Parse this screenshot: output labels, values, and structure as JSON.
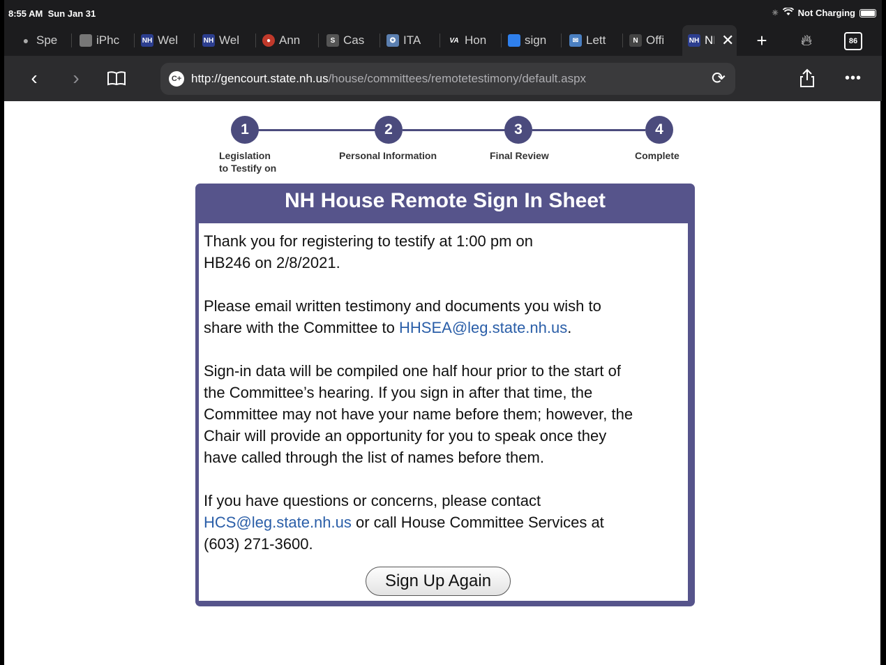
{
  "status_bar": {
    "time": "8:55 AM",
    "date": "Sun Jan 31",
    "charging": "Not Charging"
  },
  "tabs": [
    {
      "label": "Spe",
      "icon": "apple-icon",
      "color": "#555555"
    },
    {
      "label": "iPhc",
      "icon": "apple-icon",
      "color": "#777777"
    },
    {
      "label": "Wel",
      "icon": "nh-icon",
      "color": "#2c3e8f"
    },
    {
      "label": "Wel",
      "icon": "nh-icon",
      "color": "#2c3e8f"
    },
    {
      "label": "Ann",
      "icon": "seal-icon",
      "color": "#c0392b"
    },
    {
      "label": "Cas",
      "icon": "s-icon",
      "color": "#555555"
    },
    {
      "label": "ITA",
      "icon": "seal-icon",
      "color": "#5b7fb0"
    },
    {
      "label": "Hon",
      "icon": "va-icon",
      "color": "#1b2a5e"
    },
    {
      "label": "sign",
      "icon": "square-icon",
      "color": "#2f80ed"
    },
    {
      "label": "Lett",
      "icon": "mail-icon",
      "color": "#4a7fc1"
    },
    {
      "label": "Offi",
      "icon": "n-icon",
      "color": "#333333"
    },
    {
      "label": "NH \\",
      "icon": "nh-icon",
      "color": "#2c3e8f",
      "active": true
    }
  ],
  "tab_count": "86",
  "url": {
    "host": "http://gencourt.state.nh.us",
    "path": "/house/committees/remotetestimony/default.aspx"
  },
  "steps": [
    {
      "number": "1",
      "label": "Legislation\nto Testify on"
    },
    {
      "number": "2",
      "label": "Personal Information"
    },
    {
      "number": "3",
      "label": "Final Review"
    },
    {
      "number": "4",
      "label": "Complete"
    }
  ],
  "panel": {
    "title": "NH House Remote Sign In Sheet",
    "p1_line1": "Thank you for registering to testify  at 1:00 pm on",
    "p1_line2": "HB246 on 2/8/2021.",
    "p2_line1": "Please email written testimony and documents you wish to",
    "p2_line2_pre": "share with the Committee to ",
    "p2_email": "HHSEA@leg.state.nh.us",
    "p2_line2_post": ".",
    "p3_line1": "Sign-in data will be compiled one half hour prior to the start of",
    "p3_line2": "the Committee’s hearing. If you sign in after that time, the",
    "p3_line3": "Committee may not have your name before them; however, the",
    "p3_line4": "Chair will provide an opportunity for you to speak once they",
    "p3_line5": "have called through the list of names before them.",
    "p4_line1": "If you have questions or concerns, please contact",
    "p4_email": "HCS@leg.state.nh.us",
    "p4_line2_post": " or call House Committee Services at",
    "p4_line3": "(603) 271-3600.",
    "button": "Sign Up Again"
  },
  "colors": {
    "accent": "#56548b",
    "link": "#2a5ea8"
  }
}
